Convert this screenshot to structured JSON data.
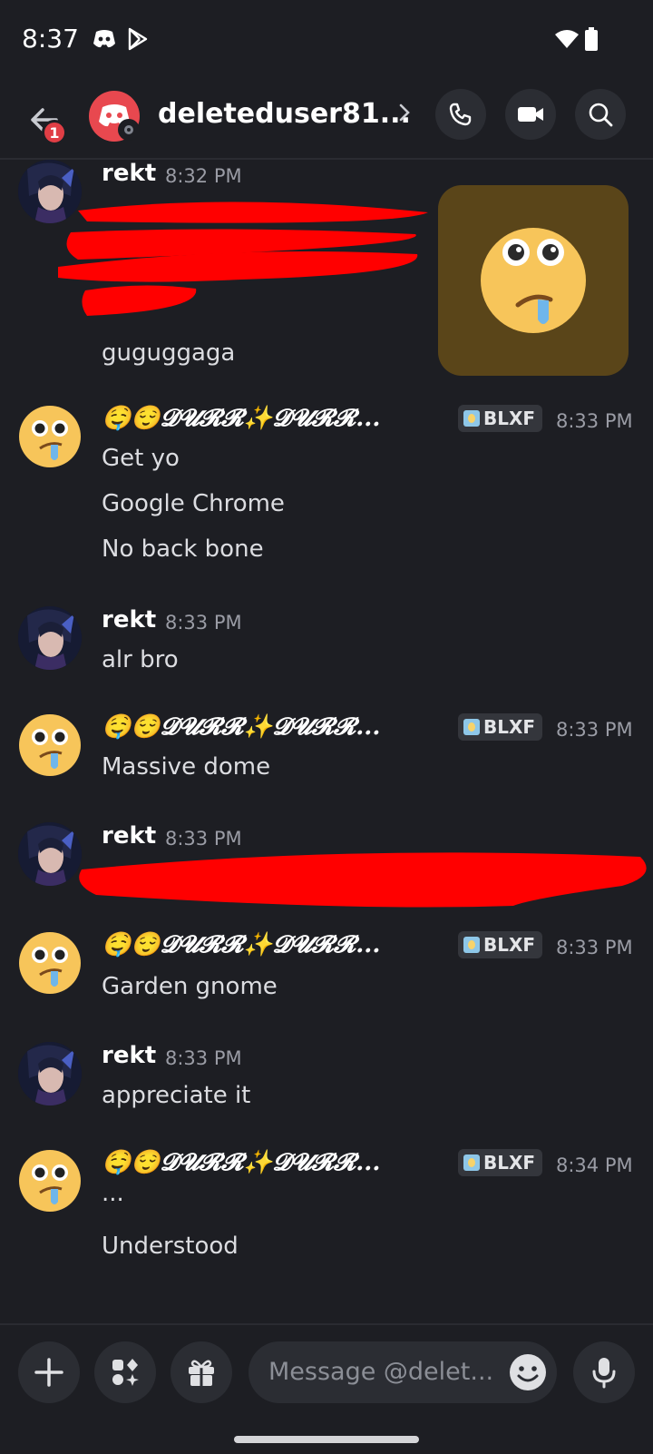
{
  "status_bar": {
    "time": "8:37"
  },
  "header": {
    "back_badge": "1",
    "dm_name": "deleteduser81..."
  },
  "messages": [
    {
      "author": "rekt",
      "time": "8:32 PM",
      "lines": [
        "guguggaga"
      ]
    },
    {
      "author": "🤤😌𝓓𝓤𝓡𝓡✨𝓓𝓤𝓡𝓡...",
      "tag": "BLXF",
      "time": "8:33 PM",
      "lines": [
        "Get yo",
        "Google Chrome",
        "No back bone"
      ]
    },
    {
      "author": "rekt",
      "time": "8:33 PM",
      "lines": [
        "alr bro"
      ]
    },
    {
      "author": "🤤😌𝓓𝓤𝓡𝓡✨𝓓𝓤𝓡𝓡...",
      "tag": "BLXF",
      "time": "8:33 PM",
      "lines": [
        "Massive dome"
      ]
    },
    {
      "author": "rekt",
      "time": "8:33 PM",
      "lines": []
    },
    {
      "author": "🤤😌𝓓𝓤𝓡𝓡✨𝓓𝓤𝓡𝓡...",
      "tag": "BLXF",
      "time": "8:33 PM",
      "lines": [
        "Garden gnome"
      ]
    },
    {
      "author": "rekt",
      "time": "8:33 PM",
      "lines": [
        "appreciate it"
      ]
    },
    {
      "author": "🤤😌𝓓𝓤𝓡𝓡✨𝓓𝓤𝓡𝓡...",
      "tag": "BLXF",
      "time": "8:34 PM",
      "lines": [
        "...",
        "Understood"
      ]
    }
  ],
  "composer": {
    "placeholder": "Message @delet..."
  },
  "colors": {
    "background": "#1d1e23",
    "redaction": "#ff0000",
    "brand": "#e8484f"
  }
}
